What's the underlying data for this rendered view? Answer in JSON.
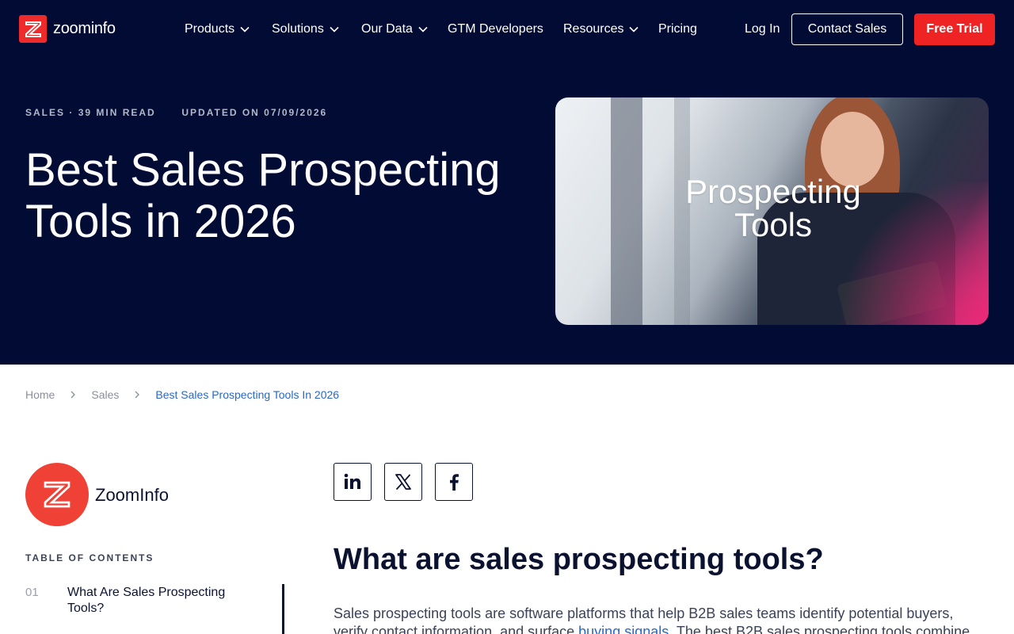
{
  "nav": {
    "logo_text": "zoominfo",
    "items": [
      {
        "label": "Products",
        "dropdown": true
      },
      {
        "label": "Solutions",
        "dropdown": true
      },
      {
        "label": "Our Data",
        "dropdown": true
      },
      {
        "label": "GTM Developers",
        "dropdown": false
      },
      {
        "label": "Resources",
        "dropdown": true
      },
      {
        "label": "Pricing",
        "dropdown": false
      }
    ],
    "login": "Log In",
    "contact": "Contact Sales",
    "trial": "Free Trial"
  },
  "hero": {
    "category": "SALES",
    "read_time": "· 39 MIN READ",
    "updated": "UPDATED ON 07/09/2026",
    "title": "Best Sales Prospecting Tools in 2026",
    "image_text_line1": "Prospecting",
    "image_text_line2": "Tools"
  },
  "breadcrumb": {
    "home": "Home",
    "section": "Sales",
    "current": "Best Sales Prospecting Tools In 2026"
  },
  "author": {
    "name": "ZoomInfo"
  },
  "toc": {
    "title": "TABLE OF CONTENTS",
    "items": [
      {
        "num": "01",
        "text": "What Are Sales Prospecting Tools?"
      }
    ]
  },
  "article": {
    "heading": "What are sales prospecting tools?",
    "para_before": "Sales prospecting tools are software platforms that help B2B sales teams identify potential buyers, verify contact information, and surface ",
    "para_link": "buying signals",
    "para_after": ". The best B2B sales prospecting tools combine"
  },
  "colors": {
    "navy": "#020b34",
    "brand_red": "#ef2323",
    "link_blue": "#2868c8"
  },
  "icons": {
    "logo": "zoominfo-z-icon",
    "dropdown": "chevron-down-icon",
    "breadcrumb_sep": "chevron-right-icon",
    "social": [
      "linkedin-icon",
      "x-twitter-icon",
      "facebook-icon"
    ]
  }
}
